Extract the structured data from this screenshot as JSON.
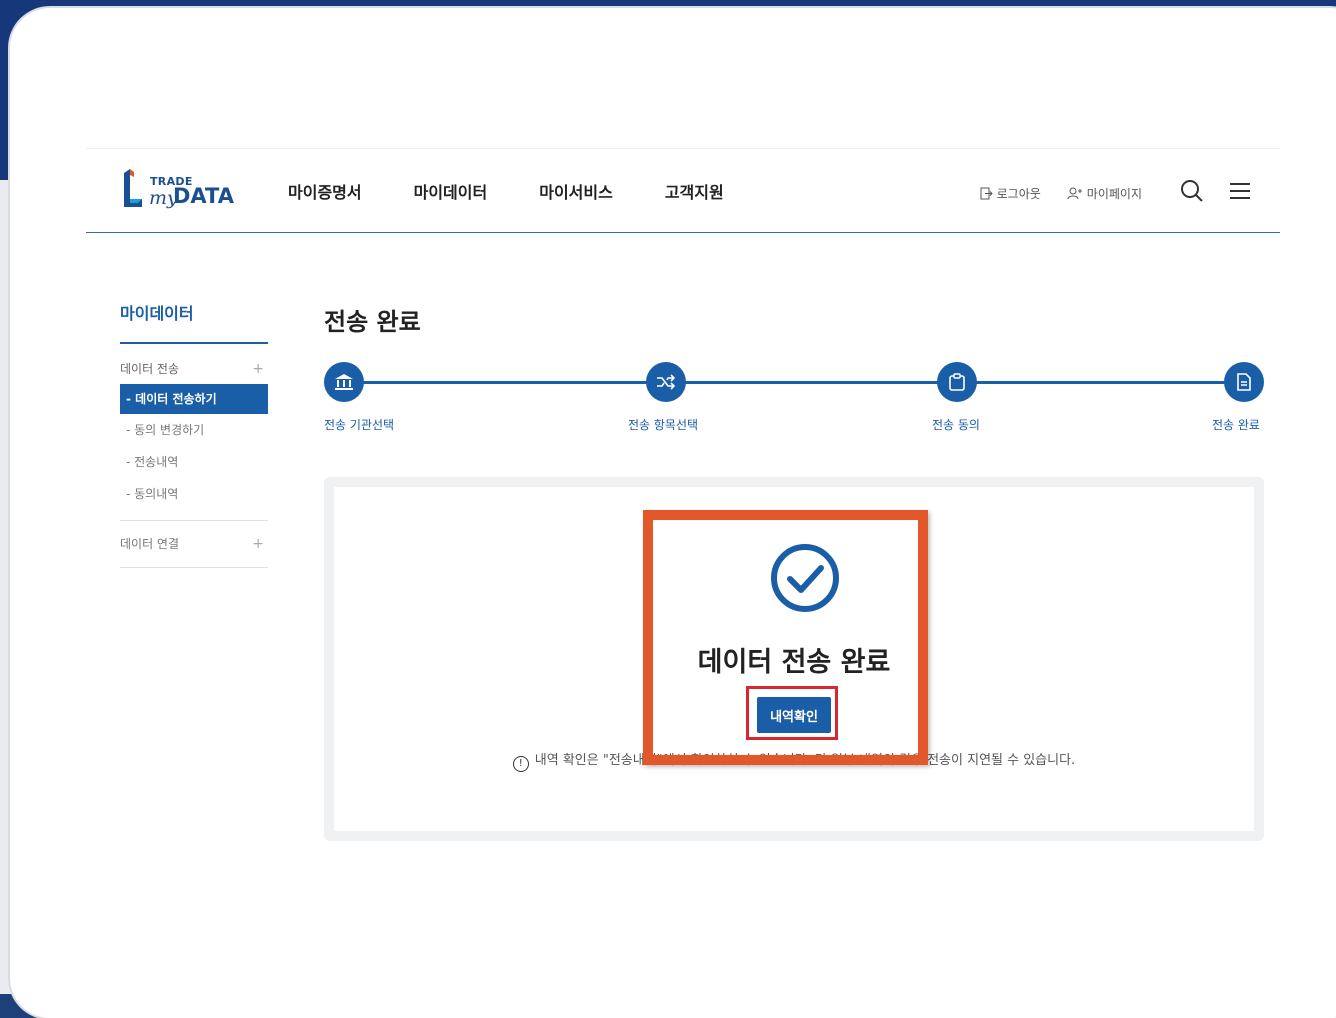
{
  "header": {
    "logo": {
      "trade": "TRADE",
      "my": "my",
      "data": "DATA"
    },
    "nav": [
      "마이증명서",
      "마이데이터",
      "마이서비스",
      "고객지원"
    ],
    "util": {
      "logout": "로그아웃",
      "mypage": "마이페이지"
    }
  },
  "sidebar": {
    "title": "마이데이터",
    "group1": "데이터 전송",
    "items": [
      "- 데이터 전송하기",
      "- 동의 변경하기",
      "- 전송내역",
      "- 동의내역"
    ],
    "group2": "데이터 연결"
  },
  "main": {
    "title": "전송 완료",
    "steps": [
      "전송 기관선택",
      "전송 항목선택",
      "전송 동의",
      "전송 완료"
    ],
    "result_title": "데이터 전송 완료",
    "confirm_button": "내역확인",
    "note": "내역 확인은 \"전송내역\"에서 확인하실 수 있습니다. 단 일부 내역의 경우 전송이 지연될 수 있습니다."
  },
  "colors": {
    "primary": "#1a5ea8",
    "highlight_orange": "#e2582a",
    "highlight_red": "#d6282e"
  }
}
